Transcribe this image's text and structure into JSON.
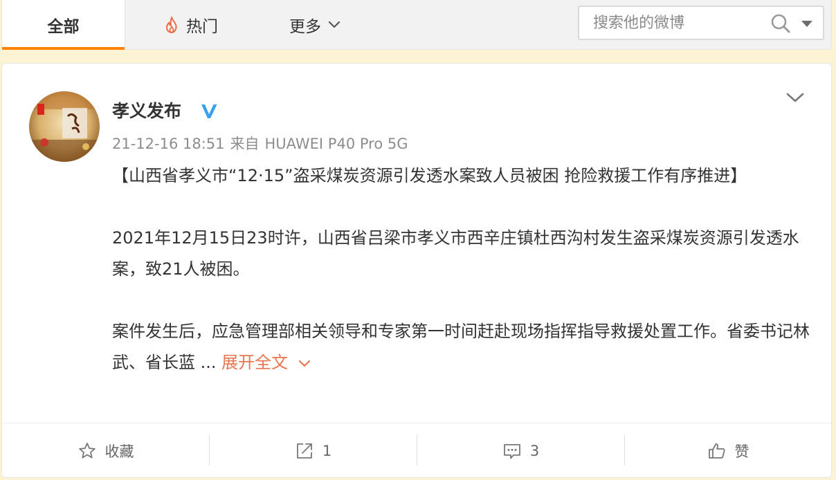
{
  "tabs": {
    "all_label": "全部",
    "hot_label": "热门",
    "more_label": "更多"
  },
  "search": {
    "placeholder": "搜索他的微博"
  },
  "post": {
    "author": "孝义发布",
    "verified_icon": "verified-v-icon",
    "timestamp": "21-12-16 18:51",
    "source_prefix": "来自",
    "device": "HUAWEI P40 Pro 5G",
    "paragraphs": [
      "【山西省孝义市“12·15”盗采煤炭资源引发透水案致人员被困 抢险救援工作有序推进】",
      "2021年12月15日23时许，山西省吕梁市孝义市西辛庄镇杜西沟村发生盗采煤炭资源引发透水案，致21人被困。",
      "案件发生后，应急管理部相关领导和专家第一时间赶赴现场指挥指导救援处置工作。省委书记林武、省长蓝 ..."
    ],
    "expand_label": "展开全文"
  },
  "actions": {
    "favorite_label": "收藏",
    "repost_count": "1",
    "comment_count": "3",
    "like_label": "赞"
  },
  "colors": {
    "accent": "#ff8200",
    "link": "#eb7350",
    "verified": "#3aa0f0",
    "page_bg": "#fbf3d3"
  }
}
